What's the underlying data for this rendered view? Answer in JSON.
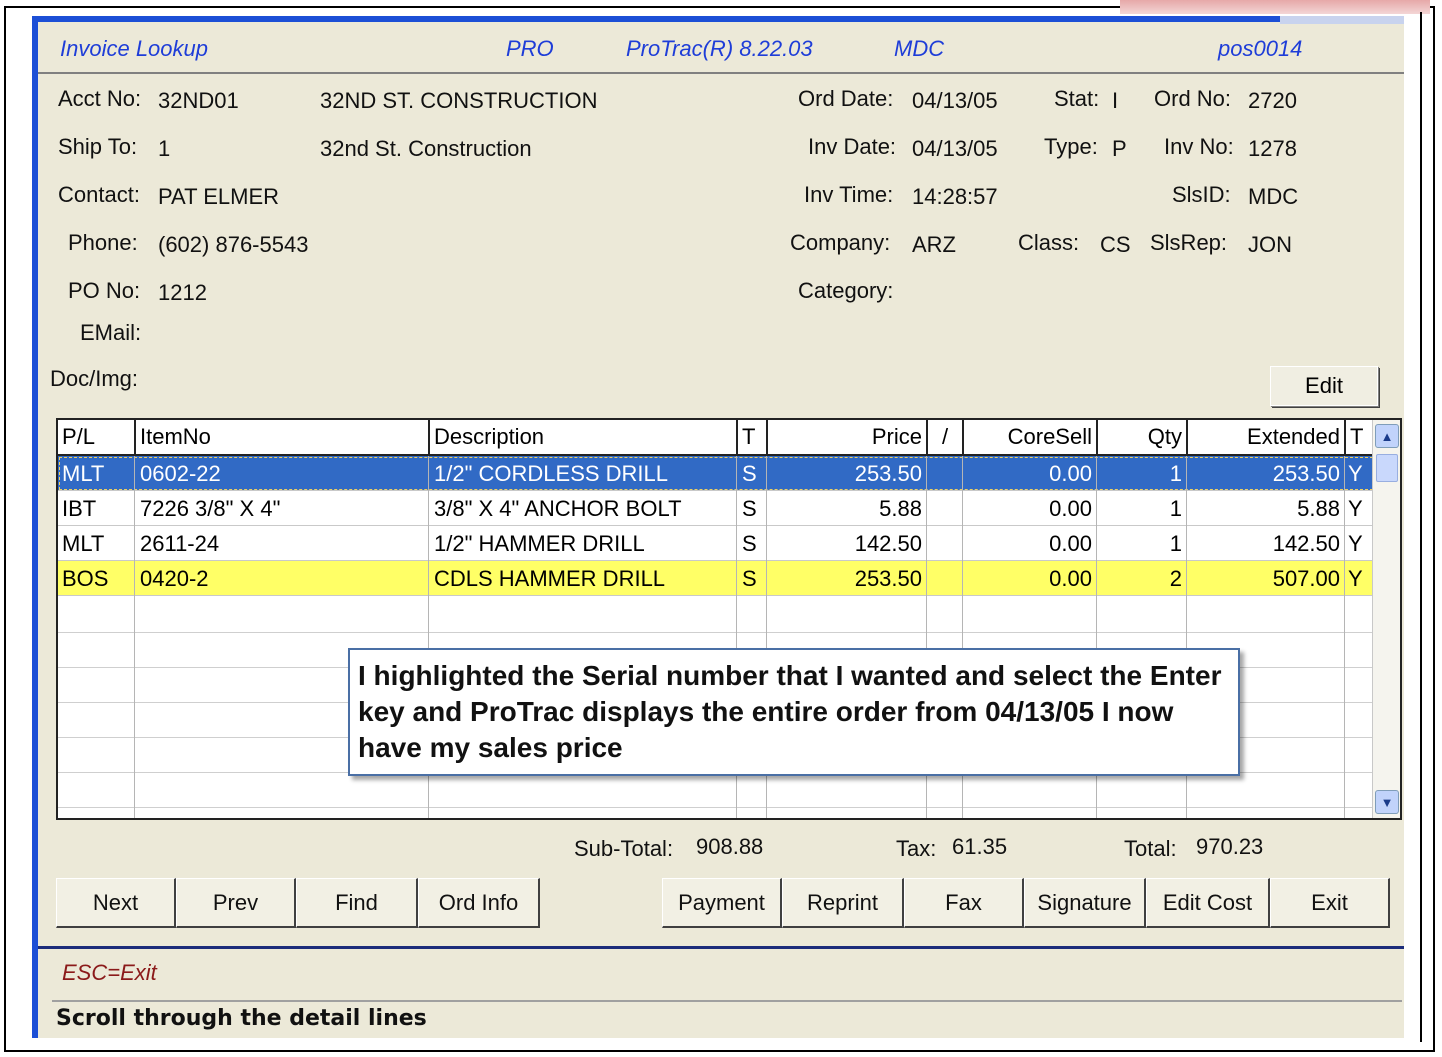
{
  "title_bar": {
    "app_title": "Invoice Lookup",
    "edition": "PRO",
    "version": "ProTrac(R) 8.22.03",
    "user": "MDC",
    "terminal": "pos0014"
  },
  "header": {
    "acct_no_label": "Acct No:",
    "acct_no": "32ND01",
    "customer_name": "32ND ST. CONSTRUCTION",
    "ship_to_label": "Ship To:",
    "ship_to": "1",
    "ship_to_name": "32nd St. Construction",
    "contact_label": "Contact:",
    "contact": "PAT ELMER",
    "phone_label": "Phone:",
    "phone": "(602) 876-5543",
    "po_no_label": "PO No:",
    "po_no": "1212",
    "email_label": "EMail:",
    "email": "",
    "docimg_label": "Doc/Img:",
    "ord_date_label": "Ord Date:",
    "ord_date": "04/13/05",
    "inv_date_label": "Inv Date:",
    "inv_date": "04/13/05",
    "inv_time_label": "Inv Time:",
    "inv_time": "14:28:57",
    "company_label": "Company:",
    "company": "ARZ",
    "category_label": "Category:",
    "stat_label": "Stat:",
    "stat": "I",
    "type_label": "Type:",
    "type": "P",
    "class_label": "Class:",
    "class": "CS",
    "ord_no_label": "Ord No:",
    "ord_no": "2720",
    "inv_no_label": "Inv No:",
    "inv_no": "1278",
    "slsid_label": "SlsID:",
    "slsid": "MDC",
    "slsrep_label": "SlsRep:",
    "slsrep": "JON",
    "edit_label": "Edit"
  },
  "grid": {
    "columns": [
      "P/L",
      "ItemNo",
      "Description",
      "T",
      "Price",
      "/",
      "CoreSell",
      "Qty",
      "Extended",
      "T"
    ],
    "rows": [
      {
        "pl": "MLT",
        "item": "0602-22",
        "desc": "1/2\" CORDLESS DRILL",
        "t": "S",
        "price": "253.50",
        "slash": "",
        "coresell": "0.00",
        "qty": "1",
        "extended": "253.50",
        "t2": "Y"
      },
      {
        "pl": "IBT",
        "item": "7226 3/8\" X 4\"",
        "desc": "3/8\" X 4\" ANCHOR BOLT",
        "t": "S",
        "price": "5.88",
        "slash": "",
        "coresell": "0.00",
        "qty": "1",
        "extended": "5.88",
        "t2": "Y"
      },
      {
        "pl": "MLT",
        "item": "2611-24",
        "desc": "1/2\" HAMMER DRILL",
        "t": "S",
        "price": "142.50",
        "slash": "",
        "coresell": "0.00",
        "qty": "1",
        "extended": "142.50",
        "t2": "Y"
      },
      {
        "pl": "BOS",
        "item": "0420-2",
        "desc": "CDLS HAMMER DRILL",
        "t": "S",
        "price": "253.50",
        "slash": "",
        "coresell": "0.00",
        "qty": "2",
        "extended": "507.00",
        "t2": "Y"
      }
    ]
  },
  "callout": {
    "text": "I highlighted the Serial number that I wanted and select the Enter key and ProTrac displays the entire order from 04/13/05 I now have my sales price"
  },
  "totals": {
    "subtotal_label": "Sub-Total:",
    "subtotal": "908.88",
    "tax_label": "Tax:",
    "tax": "61.35",
    "total_label": "Total:",
    "total": "970.23"
  },
  "buttons": {
    "next": "Next",
    "prev": "Prev",
    "find": "Find",
    "ord_info": "Ord Info",
    "payment": "Payment",
    "reprint": "Reprint",
    "fax": "Fax",
    "signature": "Signature",
    "edit_cost": "Edit Cost",
    "exit": "Exit"
  },
  "footer": {
    "esc_hint": "ESC=Exit",
    "status": "Scroll through the detail lines"
  },
  "colors": {
    "title_text": "#1e3dd8",
    "window_bg": "#ece9d8",
    "selected_row": "#316ac5",
    "highlighted_row": "#ffff66",
    "esc_text": "#8b1a1a"
  },
  "icons": [
    "scroll-up-icon",
    "scroll-down-icon"
  ]
}
